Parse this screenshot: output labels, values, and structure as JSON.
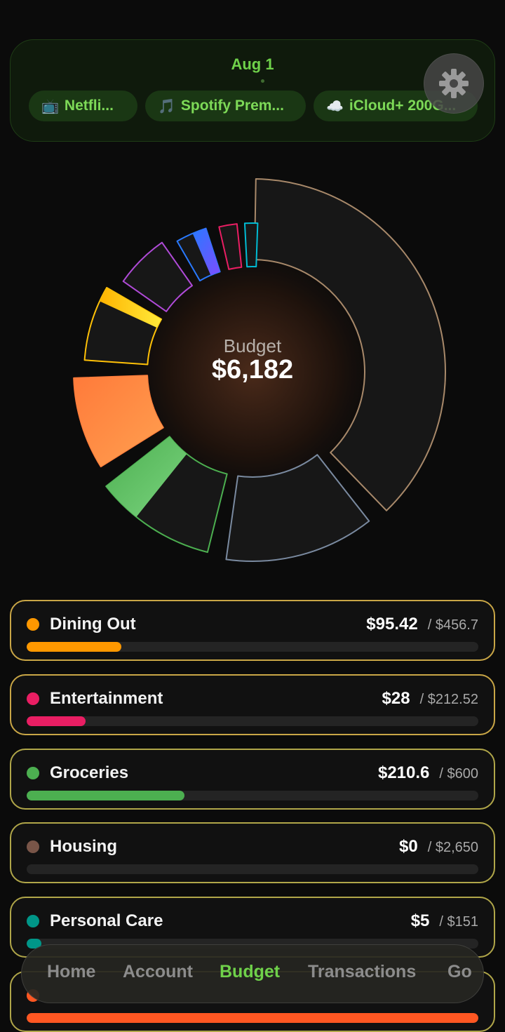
{
  "subscriptions": {
    "date": "Aug 1",
    "items": [
      {
        "icon": "📺",
        "label": "Netfli..."
      },
      {
        "icon": "🎵",
        "label": "Spotify Prem..."
      },
      {
        "icon": "☁️",
        "label": "iCloud+ 200G..."
      }
    ]
  },
  "budget": {
    "title": "Budget",
    "amount": "$6,182"
  },
  "categories": [
    {
      "name": "Dining Out",
      "spent": "$95.42",
      "limit": "/ $456.7",
      "color": "#ff9800",
      "progress": 0.21
    },
    {
      "name": "Entertainment",
      "spent": "$28",
      "limit": "/ $212.52",
      "color": "#e91e63",
      "progress": 0.13
    },
    {
      "name": "Groceries",
      "spent": "$210.6",
      "limit": "/ $600",
      "color": "#4caf50",
      "progress": 0.35
    },
    {
      "name": "Housing",
      "spent": "$0",
      "limit": "/ $2,650",
      "color": "#795548",
      "progress": 0
    },
    {
      "name": "Personal Care",
      "spent": "$5",
      "limit": "/ $151",
      "color": "#009688",
      "progress": 0.033
    },
    {
      "name": "",
      "spent": "",
      "limit": "",
      "color": "#ff5722",
      "progress": 1.0
    }
  ],
  "nav": {
    "items": [
      "Home",
      "Account",
      "Budget",
      "Transactions",
      "Go"
    ],
    "active": "Budget"
  },
  "colors": {
    "accent_green": "#6fd14a"
  }
}
